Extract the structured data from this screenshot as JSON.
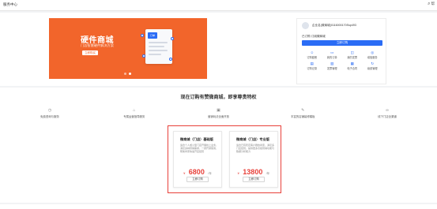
{
  "topbar": {
    "title": "服务中心",
    "right_icon": "search-icon",
    "right_label": "帮"
  },
  "banner": {
    "headline": "硬件商城",
    "subline": "门店智慧硬件解决方案",
    "button_label": "立即购买",
    "doc_tag": "订单",
    "slides_total": 2,
    "slide_active": 2
  },
  "account": {
    "account_label": "企业名(微商城)0116000170Ssp493",
    "plan_label": "已订购 订阅微商城",
    "order_button": "立即订购",
    "shortcuts": [
      {
        "icon": "users-icon",
        "label": "订购套餐"
      },
      {
        "icon": "card-icon",
        "label": "我的订单"
      },
      {
        "icon": "bag-icon",
        "label": "我的发票"
      },
      {
        "icon": "service-icon",
        "label": "增值服务"
      },
      {
        "icon": "doc-icon",
        "label": "订购记录"
      },
      {
        "icon": "invoice-icon",
        "label": "发票管理"
      },
      {
        "icon": "contract-icon",
        "label": "电子合同"
      },
      {
        "icon": "renew-icon",
        "label": "续费管理"
      }
    ]
  },
  "section_title": "现在订购有赞微商城，即享尊贵特权",
  "features": [
    {
      "icon": "clock-icon",
      "label": "免费咨询与服务"
    },
    {
      "icon": "shop-icon",
      "label": "专属运营指导服务"
    },
    {
      "icon": "gift-icon",
      "label": "营销玩法全面开放"
    },
    {
      "icon": "edit-icon",
      "label": "丰富的店铺装修模板"
    },
    {
      "icon": "link-icon",
      "label": "线下门店全渠道"
    }
  ],
  "plans": [
    {
      "name": "微商城（门店）基础版",
      "desc": "适合个人或小型门店开展线上业务，满足多种营销需求，一键开通使用，帮助商家快速开店经营",
      "currency": "¥",
      "price": "6800",
      "unit": "/年",
      "button": "立即订购"
    },
    {
      "name": "微商城（门店）专业版",
      "desc": "适合已有稳定客户群的商家，满足多门店经营，提供更多高级营销功能与数据分析能力",
      "currency": "¥",
      "price": "13800",
      "unit": "/年",
      "button": "立即订购"
    }
  ],
  "colors": {
    "accent": "#2a6cf5",
    "banner": "#f2652b",
    "highlight": "#e8413a"
  }
}
